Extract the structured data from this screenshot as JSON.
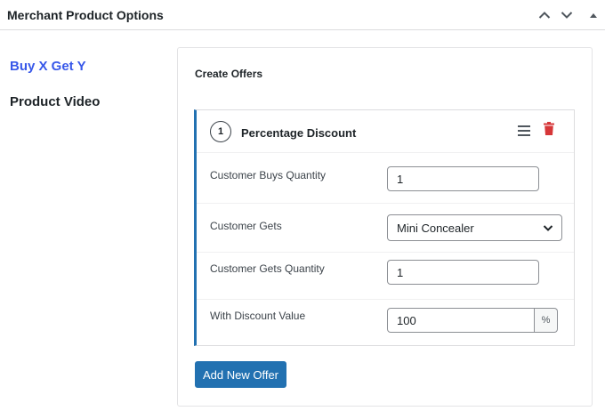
{
  "header": {
    "title": "Merchant Product Options",
    "controls": [
      "chevron-up-icon",
      "chevron-down-icon",
      "caret-up-icon"
    ]
  },
  "tabs": [
    {
      "label": "Buy X Get Y",
      "active": true
    },
    {
      "label": "Product Video",
      "active": false
    }
  ],
  "main": {
    "section_title": "Create Offers",
    "offer": {
      "number": "1",
      "title": "Percentage Discount",
      "fields": {
        "buys_qty_label": "Customer Buys Quantity",
        "buys_qty_value": "1",
        "gets_label": "Customer Gets",
        "gets_value": "Mini Concealer",
        "gets_qty_label": "Customer Gets Quantity",
        "gets_qty_value": "1",
        "discount_label": "With Discount Value",
        "discount_value": "100",
        "discount_suffix": "%"
      }
    },
    "add_button": "Add New Offer"
  },
  "colors": {
    "accent": "#2271b1",
    "active_tab": "#3858e9",
    "delete": "#d63638"
  }
}
